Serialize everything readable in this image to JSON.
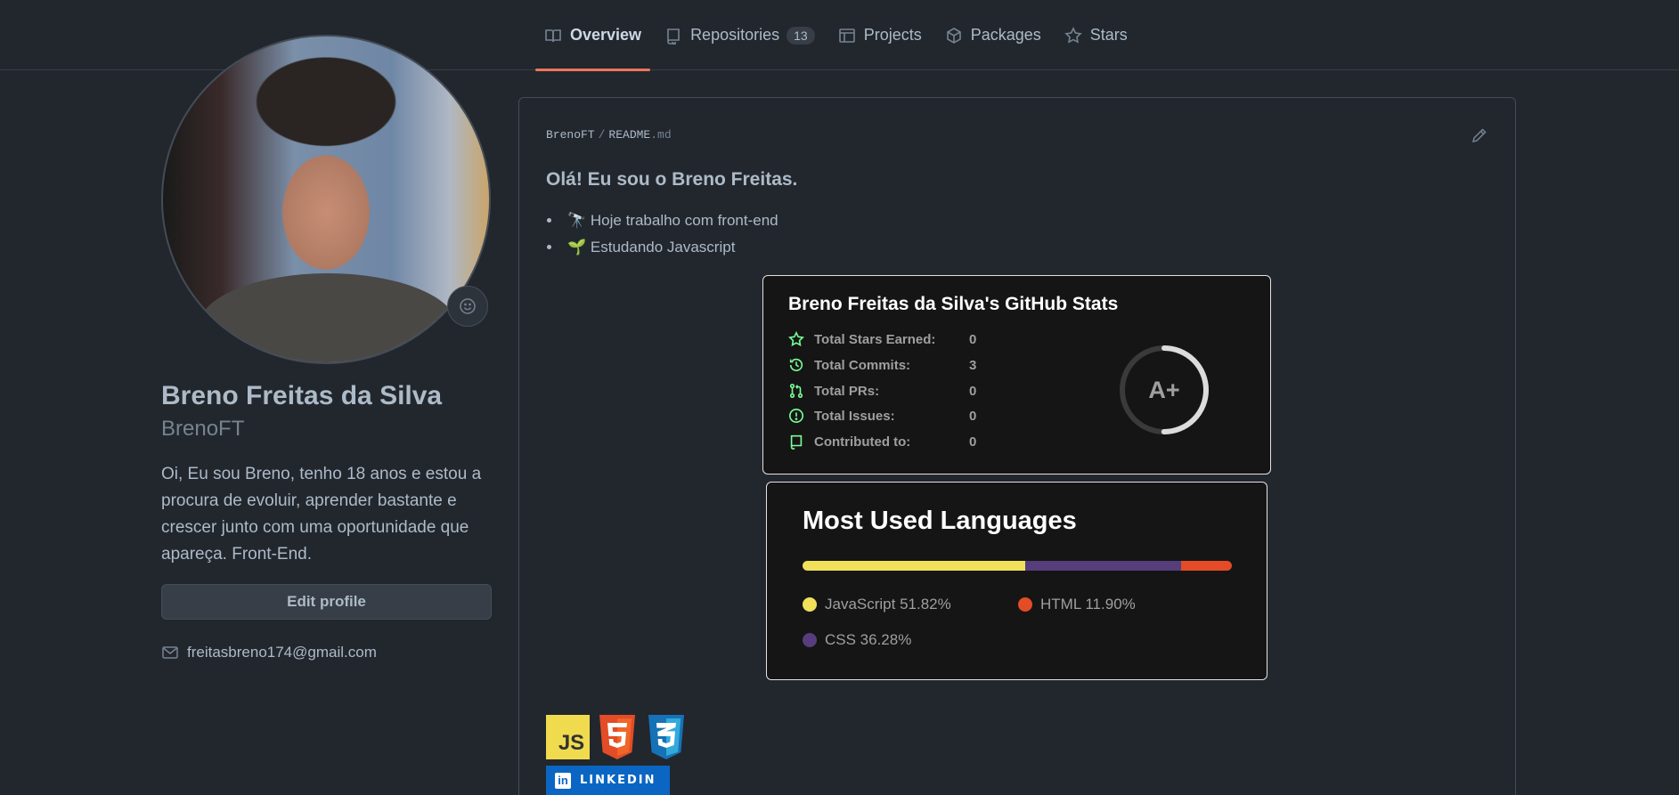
{
  "nav": {
    "tabs": [
      {
        "label": "Overview",
        "icon": "book-icon"
      },
      {
        "label": "Repositories",
        "icon": "repo-icon",
        "count": "13"
      },
      {
        "label": "Projects",
        "icon": "table-icon"
      },
      {
        "label": "Packages",
        "icon": "package-icon"
      },
      {
        "label": "Stars",
        "icon": "star-icon"
      }
    ],
    "active_tab": "Overview",
    "accent": "#ec775c"
  },
  "profile": {
    "full_name": "Breno Freitas da Silva",
    "username": "BrenoFT",
    "bio": "Oi, Eu sou Breno, tenho 18 anos e estou a procura de evoluir, aprender bastante e crescer junto com uma oportunidade que apareça. Front-End.",
    "edit_label": "Edit profile",
    "email": "freitasbreno174@gmail.com"
  },
  "readme": {
    "owner": "BrenoFT",
    "file": "README",
    "ext": ".md",
    "heading": "Olá! Eu sou o Breno Freitas.",
    "bullets": [
      "🔭 Hoje trabalho com front-end",
      "🌱 Estudando Javascript"
    ]
  },
  "stats_card": {
    "title": "Breno Freitas da Silva's GitHub Stats",
    "rows": [
      {
        "label": "Total Stars Earned:",
        "value": "0",
        "icon": "star-icon"
      },
      {
        "label": "Total Commits:",
        "value": "3",
        "icon": "history-icon"
      },
      {
        "label": "Total PRs:",
        "value": "0",
        "icon": "pull-request-icon"
      },
      {
        "label": "Total Issues:",
        "value": "0",
        "icon": "issue-icon"
      },
      {
        "label": "Contributed to:",
        "value": "0",
        "icon": "repo-icon"
      }
    ],
    "grade": "A+",
    "grade_progress": 0.5,
    "icon_color": "#79ff97"
  },
  "languages_card": {
    "title": "Most Used Languages",
    "languages": [
      {
        "name": "JavaScript 51.82%",
        "percent": 51.82,
        "color": "#f1e05a"
      },
      {
        "name": "CSS 36.28%",
        "percent": 36.28,
        "color": "#563d7c"
      },
      {
        "name": "HTML 11.90%",
        "percent": 11.9,
        "color": "#e34c26"
      }
    ]
  },
  "badges": {
    "js_text": "JS",
    "html_icon": "html5-icon",
    "css_icon": "css3-icon",
    "linkedin_label": "LINKEDIN",
    "linkedin_icon_text": "in"
  }
}
